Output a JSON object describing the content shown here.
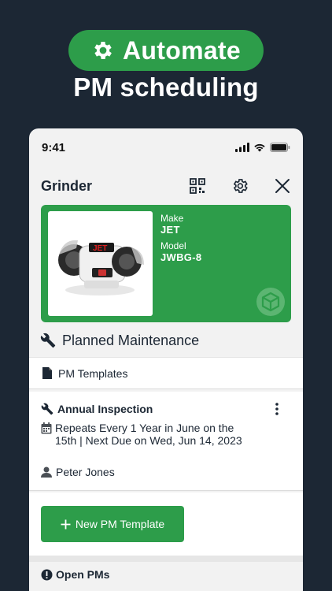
{
  "promo": {
    "pill_label": "Automate",
    "subtitle": "PM scheduling",
    "icon": "gear-icon"
  },
  "status_bar": {
    "time": "9:41",
    "icons": [
      "signal-icon",
      "wifi-icon",
      "battery-icon"
    ]
  },
  "header": {
    "title": "Grinder",
    "actions": [
      "qr-code-icon",
      "settings-icon",
      "close-icon"
    ]
  },
  "asset": {
    "make_label": "Make",
    "make_value": "JET",
    "model_label": "Model",
    "model_value": "JWBG-8",
    "photo_brand": "JET",
    "colors": {
      "card": "#2d9d4a"
    }
  },
  "planned_maintenance": {
    "title": "Planned Maintenance",
    "templates_label": "PM Templates",
    "inspection": {
      "title": "Annual Inspection",
      "repeat_text": "Repeats Every 1 Year in June on the 15th | Next Due on Wed, Jun 14, 2023",
      "assignee": "Peter Jones"
    },
    "new_template_label": "New PM Template"
  },
  "open_pms": {
    "label": "Open PMs"
  },
  "colors": {
    "background": "#1c2734",
    "accent": "#2d9d4a"
  }
}
